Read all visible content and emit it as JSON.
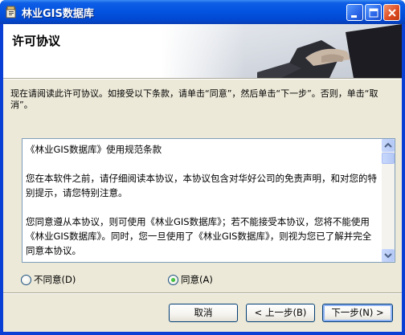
{
  "window": {
    "title": "林业GIS数据库",
    "buttons": [
      "minimize",
      "maximize",
      "close"
    ]
  },
  "header": {
    "title": "许可协议"
  },
  "instruction": "现在请阅读此许可协议。如接受以下条款，请单击“同意”，然后单击“下一步”。否则，单击“取消”。",
  "license": {
    "paragraphs": [
      "《林业GIS数据库》使用规范条款",
      "您在本软件之前，请仔细阅读本协议，本协议包含对华好公司的免责声明，和对您的特别提示，请您特别注意。",
      "您同意遵从本协议，则可使用《林业GIS数据库》；若不能接受本协议，您将不能使用《林业GIS数据库》。同时，您一旦使用了《林业GIS数据库》，则视为您已了解并完全同意本协议。"
    ]
  },
  "options": {
    "disagree": {
      "label": "不同意(D)",
      "selected": false
    },
    "agree": {
      "label": "同意(A)",
      "selected": true
    }
  },
  "footer": {
    "cancel_label": "取消",
    "back_label": "< 上一步(B)",
    "next_label": "下一步(N) >"
  },
  "colors": {
    "titlebar": "#0454e1",
    "dialog_bg": "#ece9d8",
    "radio_dot": "#21a121"
  }
}
